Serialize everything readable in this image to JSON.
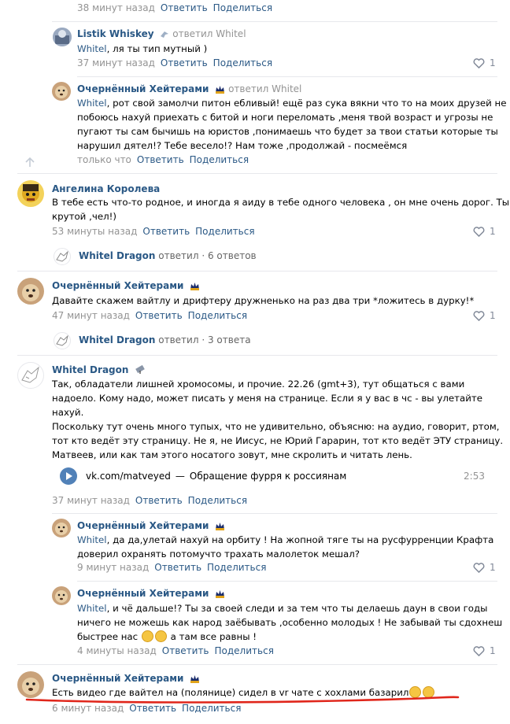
{
  "c0": {
    "time": "38 минут назад",
    "reply": "Ответить",
    "share": "Поделиться"
  },
  "c1": {
    "author": "Listik Whiskey",
    "replied_to": "ответил Whitel",
    "mention": "Whitel",
    "text": ", ля ты тип мутный )",
    "time": "37 минут назад",
    "reply": "Ответить",
    "share": "Поделиться",
    "likes": "1"
  },
  "c2": {
    "author": "Очернённый Хейтерами",
    "replied_to": "ответил Whitel",
    "mention": "Whitel",
    "line1": ", рот свой замолчи питон ебливый! ещё раз сука вякни что то на моих друзей не",
    "line2": "побоюсь нахуй приехать с битой и ноги переломать ,меня твой возраст и угрозы не",
    "line3": "пугают ты сам бычишь на юристов ,понимаешь что будет за твои статьи которые ты",
    "line4": "нарушил дятел!? Тебе весело!? Нам тоже ,продолжай - посмеёмся",
    "time": "только что",
    "reply": "Ответить",
    "share": "Поделиться"
  },
  "c3": {
    "author": "Ангелина Королева",
    "line1": "В тебе есть что-то родное, и иногда я аиду в тебе одного человека , он мне очень дорог. Ты",
    "line2": "крутой ,чел!)",
    "time": "53 минуты назад",
    "reply": "Ответить",
    "share": "Поделиться",
    "likes": "1"
  },
  "t1": {
    "author": "Whitel Dragon",
    "action": "ответил",
    "count": "6 ответов"
  },
  "c4": {
    "author": "Очернённый Хейтерами",
    "text": "Давайте скажем вайтлу и дрифтеру дружненько на раз два три *ложитесь в дурку!*",
    "time": "47 минут назад",
    "reply": "Ответить",
    "share": "Поделиться",
    "likes": "1"
  },
  "t2": {
    "author": "Whitel Dragon",
    "action": "ответил",
    "count": "3 ответа"
  },
  "c5": {
    "author": "Whitel Dragon",
    "line1": "Так, обладатели лишней хромосомы, и прочие. 22.26 (gmt+3), тут общаться с вами",
    "line2": "надоело. Кому надо, может писать у меня на странице. Если я у вас в чс - вы улетайте",
    "line3": "нахуй.",
    "line4": "Поскольку тут очень много тупых, что не удивительно, объясню: на аудио, говорит, ртом,",
    "line5": "тот кто ведёт эту страницу. Не я, не Иисус, не Юрий Гарарин, тот кто ведёт ЭТУ страницу.",
    "line6": "Матвеев, или как там этого носатого зовут, мне скролить и читать лень.",
    "audio": {
      "artist": "vk.com/matveyed",
      "dash": "—",
      "title": "Обращение фурря к россиянам",
      "duration": "2:53"
    },
    "time": "37 минут назад",
    "reply": "Ответить",
    "share": "Поделиться"
  },
  "c6": {
    "author": "Очернённый Хейтерами",
    "mention": "Whitel",
    "line1": ", да да,улетай нахуй на орбиту ! На жопной тяге ты на русфурренции Крафта",
    "line2": "доверил охранять потомучто трахать малолеток мешал?",
    "time": "9 минут назад",
    "reply": "Ответить",
    "share": "Поделиться",
    "likes": "1"
  },
  "c7": {
    "author": "Очернённый Хейтерами",
    "mention": "Whitel",
    "line1": ", и чё дальше!? Ты за своей следи и за тем что ты делаешь даун в свои годы",
    "line2": "ничего не можешь как народ заёбывать ,особенно молодых ! Не забывай ты сдохнеш",
    "line3a": "быстрее нас",
    "line3b": "а там все равны !",
    "time": "4 минуты назад",
    "reply": "Ответить",
    "share": "Поделиться",
    "likes": "1"
  },
  "c8": {
    "author": "Очернённый Хейтерами",
    "text": "Есть видео где вайтел на (полянице) сидел в vr чате с хохлами базарил",
    "time": "6 минут назад",
    "reply": "Ответить",
    "share": "Поделиться"
  },
  "colors": {
    "link": "#2a5885",
    "muted": "#939393",
    "annotation": "#e0261b"
  }
}
